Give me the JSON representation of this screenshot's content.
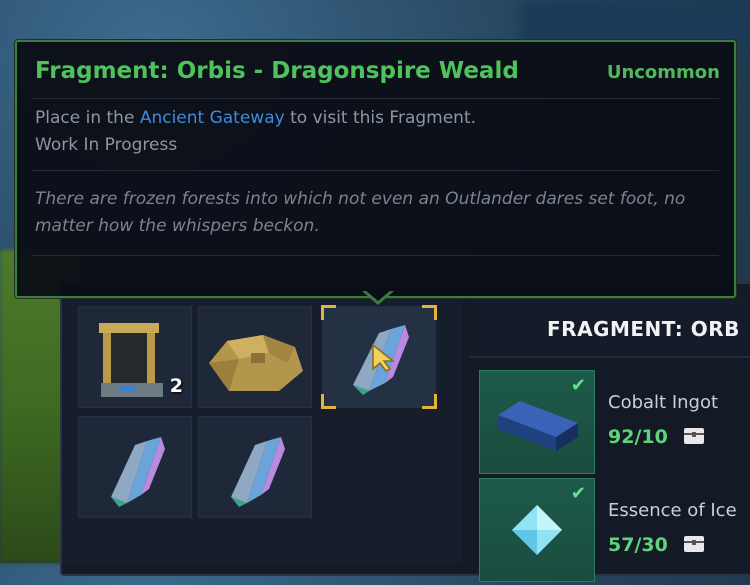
{
  "tooltip": {
    "title": "Fragment: Orbis - Dragonspire Weald",
    "rarity": "Uncommon",
    "line1_pre": "Place in the ",
    "line1_link": "Ancient Gateway",
    "line1_post": " to visit this Fragment.",
    "line2": "Work In Progress",
    "flavor": "There are frozen forests into which not even an Outlander dares set foot, no matter how the whispers beckon.",
    "colors": {
      "title": "#4fc25b",
      "rarity": "#4fb85a",
      "link": "#3f8be0",
      "border": "#3f7a44"
    }
  },
  "inventory": {
    "slots": [
      {
        "item": "ancient-gateway-icon",
        "count": "2"
      },
      {
        "item": "rubble-stone-icon",
        "count": ""
      },
      {
        "item": "crystal-fragment-icon",
        "count": "",
        "selected": true
      },
      {
        "item": "crystal-fragment-icon",
        "count": ""
      },
      {
        "item": "crystal-fragment-icon",
        "count": ""
      }
    ]
  },
  "recipe": {
    "title": "FRAGMENT: ORB",
    "ingredients": [
      {
        "name": "Cobalt Ingot",
        "count": "92/10",
        "icon": "cobalt-ingot-icon",
        "complete": true
      },
      {
        "name": "Essence of Ice",
        "count": "57/30",
        "icon": "ice-essence-icon",
        "complete": true
      }
    ]
  }
}
